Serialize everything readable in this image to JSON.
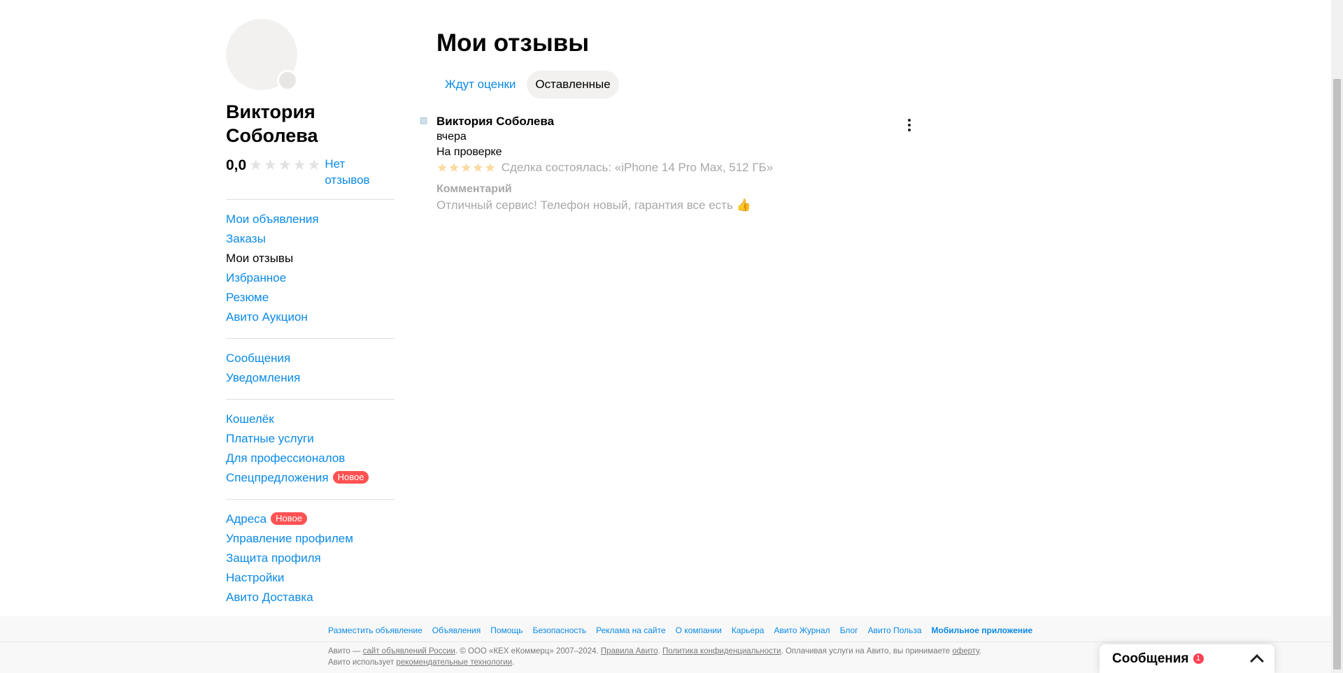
{
  "profile": {
    "name": "Виктория Соболева",
    "rating": "0,0",
    "no_reviews": "Нет отзывов"
  },
  "nav": {
    "group1": [
      {
        "label": "Мои объявления",
        "active": false
      },
      {
        "label": "Заказы",
        "active": false
      },
      {
        "label": "Мои отзывы",
        "active": true
      },
      {
        "label": "Избранное",
        "active": false
      },
      {
        "label": "Резюме",
        "active": false
      },
      {
        "label": "Авито Аукцион",
        "active": false
      }
    ],
    "group2": [
      {
        "label": "Сообщения"
      },
      {
        "label": "Уведомления"
      }
    ],
    "group3": [
      {
        "label": "Кошелёк"
      },
      {
        "label": "Платные услуги"
      },
      {
        "label": "Для профессионалов"
      },
      {
        "label": "Спецпредложения",
        "badge": "Новое"
      }
    ],
    "group4": [
      {
        "label": "Адреса",
        "badge": "Новое"
      },
      {
        "label": "Управление профилем"
      },
      {
        "label": "Защита профиля"
      },
      {
        "label": "Настройки"
      },
      {
        "label": "Авито Доставка"
      }
    ]
  },
  "main": {
    "title": "Мои отзывы",
    "tabs": [
      {
        "label": "Ждут оценки",
        "selected": false
      },
      {
        "label": "Оставленные",
        "selected": true
      }
    ]
  },
  "review": {
    "author": "Виктория Соболева",
    "date": "вчера",
    "status": "На проверке",
    "stars": 5,
    "deal": "Сделка состоялась: «iPhone 14 Pro Max, 512 ГБ»",
    "comment_label": "Комментарий",
    "comment_text": "Отличный сервис! Телефон новый, гарантия все есть",
    "comment_emoji": "👍"
  },
  "footer": {
    "links": [
      {
        "label": "Разместить объявление",
        "bold": false
      },
      {
        "label": "Объявления",
        "bold": false
      },
      {
        "label": "Помощь",
        "bold": false
      },
      {
        "label": "Безопасность",
        "bold": false
      },
      {
        "label": "Реклама на сайте",
        "bold": false
      },
      {
        "label": "О компании",
        "bold": false
      },
      {
        "label": "Карьера",
        "bold": false
      },
      {
        "label": "Авито Журнал",
        "bold": false
      },
      {
        "label": "Блог",
        "bold": false
      },
      {
        "label": "Авито Польза",
        "bold": false
      },
      {
        "label": "Мобильное приложение",
        "bold": true
      }
    ],
    "copy": {
      "p1": "Авито — ",
      "l1": "сайт объявлений России",
      "p2": ". © ООО «КЕХ еКоммерц» 2007–2024. ",
      "l2": "Правила Авито",
      "p3": ". ",
      "l3": "Политика конфиденциальности",
      "p4": ". Оплачивая услуги на Авито, вы принимаете ",
      "l4": "оферту",
      "p5": ". Авито использует ",
      "l5": "рекомендательные технологии",
      "p6": "."
    }
  },
  "messages_widget": {
    "label": "Сообщения",
    "count": "1"
  },
  "colors": {
    "link": "#0a8ae8",
    "badge": "#ff5252",
    "star_filled": "#fbd89b",
    "star_empty": "#e2e2e2"
  }
}
